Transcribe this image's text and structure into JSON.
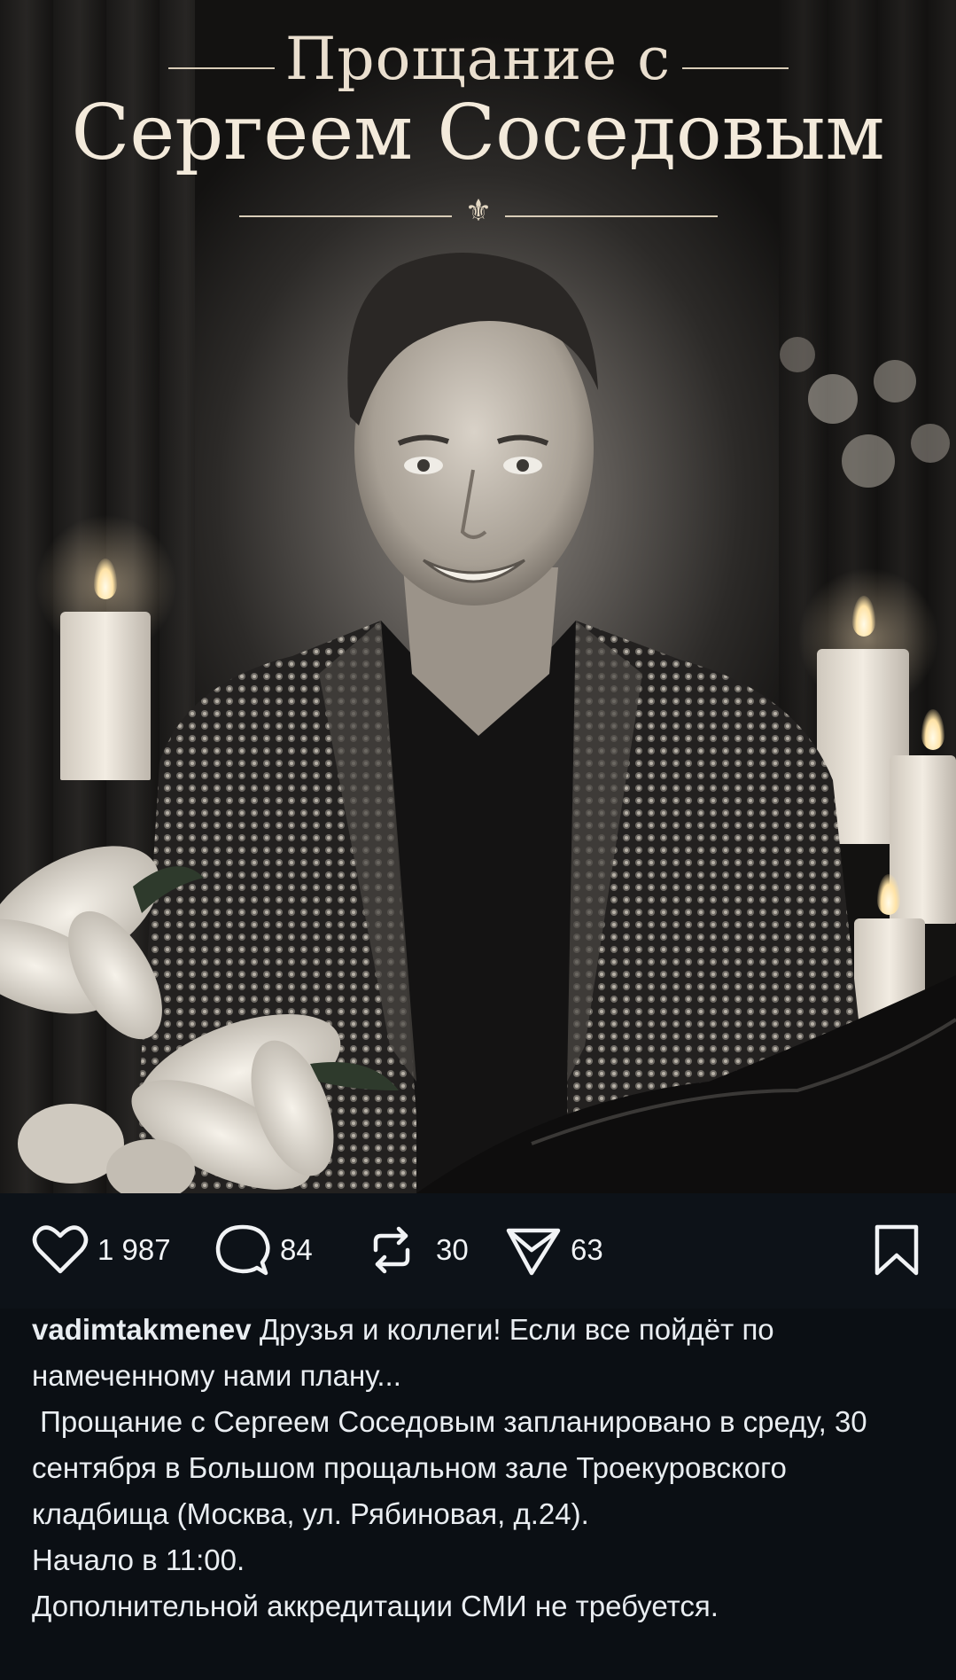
{
  "post": {
    "title_line1": "Прощание с",
    "title_line2": "Сергеем Соседовым"
  },
  "actions": {
    "likes": "1 987",
    "comments": "84",
    "reposts": "30",
    "shares": "63"
  },
  "caption": {
    "username": "vadimtakmenev",
    "line1": "Друзья и коллеги! Если все пойдёт по намеченному нами плану...",
    "line2": " Прощание с Сергеем Соседовым запланировано в среду, 30 сентября в Большом прощальном зале Троекуровского кладбища (Москва, ул. Рябиновая, д.24).",
    "line3": "Начало в 11:00.",
    "line4": "Дополнительной аккредитации СМИ не требуется."
  },
  "colors": {
    "background": "#0b0f14",
    "text": "#e9edf1",
    "icon": "#f1f3f5"
  }
}
